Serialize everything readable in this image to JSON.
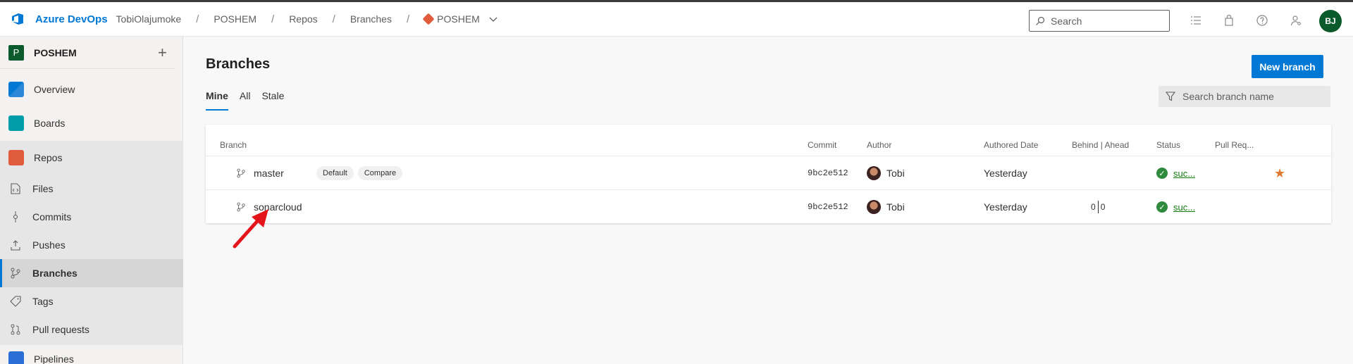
{
  "header": {
    "brand": "Azure DevOps",
    "org": "TobiOlajumoke",
    "breadcrumbs": [
      "POSHEM",
      "Repos",
      "Branches"
    ],
    "repo": "POSHEM",
    "search_placeholder": "Search",
    "user_initials": "BJ"
  },
  "sidebar": {
    "project_name": "POSHEM",
    "project_initial": "P",
    "items": [
      {
        "label": "Overview"
      },
      {
        "label": "Boards"
      },
      {
        "label": "Repos"
      },
      {
        "label": "Files"
      },
      {
        "label": "Commits"
      },
      {
        "label": "Pushes"
      },
      {
        "label": "Branches"
      },
      {
        "label": "Tags"
      },
      {
        "label": "Pull requests"
      },
      {
        "label": "Pipelines"
      }
    ]
  },
  "main": {
    "title": "Branches",
    "new_branch_label": "New branch",
    "tabs": [
      "Mine",
      "All",
      "Stale"
    ],
    "active_tab": "Mine",
    "branch_search_placeholder": "Search branch name",
    "columns": [
      "Branch",
      "Commit",
      "Author",
      "Authored Date",
      "Behind | Ahead",
      "Status",
      "Pull Req..."
    ],
    "rows": [
      {
        "name": "master",
        "tags": [
          "Default",
          "Compare"
        ],
        "commit": "9bc2e512",
        "author": "Tobi",
        "date": "Yesterday",
        "behind": "",
        "ahead": "",
        "status": "suc...",
        "favorite": true
      },
      {
        "name": "sonarcloud",
        "tags": [],
        "commit": "9bc2e512",
        "author": "Tobi",
        "date": "Yesterday",
        "behind": "0",
        "ahead": "0",
        "status": "suc...",
        "favorite": false
      }
    ]
  },
  "colors": {
    "accent": "#0078d4",
    "success": "#107c10",
    "favorite": "#e07a2f",
    "annotation_arrow": "#e3141a"
  }
}
